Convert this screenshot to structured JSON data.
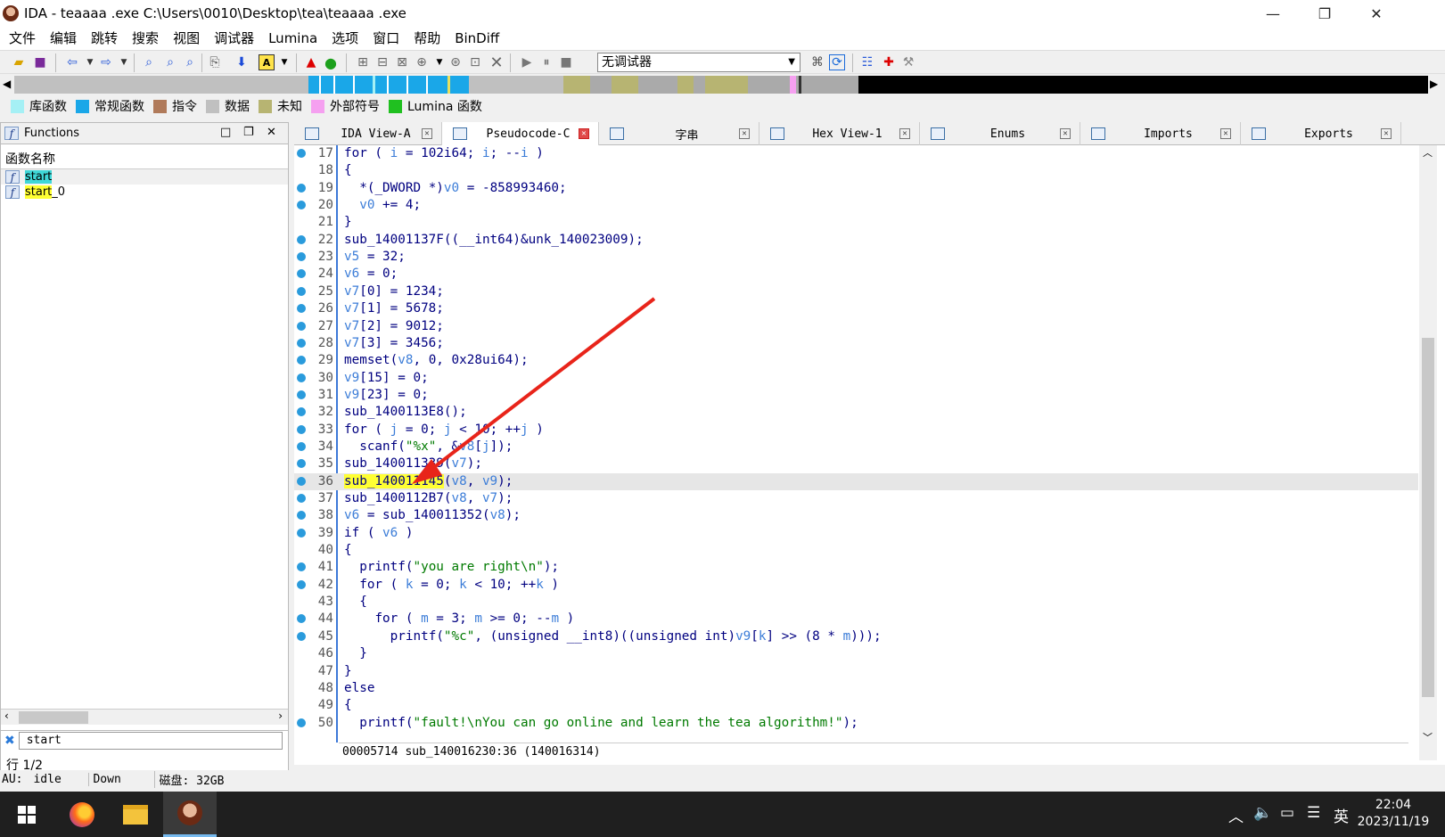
{
  "window": {
    "title": "IDA - teaaaa .exe C:\\Users\\0010\\Desktop\\tea\\teaaaa .exe",
    "minimize_glyph": "—",
    "maximize_glyph": "❐",
    "close_glyph": "✕"
  },
  "menu": [
    "文件",
    "编辑",
    "跳转",
    "搜索",
    "视图",
    "调试器",
    "Lumina",
    "选项",
    "窗口",
    "帮助",
    "BinDiff"
  ],
  "toolbar": {
    "debugger_select": "无调试器"
  },
  "legend": [
    {
      "label": "库函数",
      "color": "#a5f0f5"
    },
    {
      "label": "常规函数",
      "color": "#1aa7e8"
    },
    {
      "label": "指令",
      "color": "#b07a5a"
    },
    {
      "label": "数据",
      "color": "#c0c0c0"
    },
    {
      "label": "未知",
      "color": "#b7b472"
    },
    {
      "label": "外部符号",
      "color": "#f5a0f0"
    },
    {
      "label": "Lumina 函数",
      "color": "#20c020"
    }
  ],
  "functions_panel": {
    "title": "Functions",
    "column_header": "函数名称",
    "items": [
      "start",
      "start_0"
    ],
    "filter_value": "start",
    "status": "行 1/2"
  },
  "tabs": [
    {
      "label": "IDA View-A",
      "active": false
    },
    {
      "label": "Pseudocode-C",
      "active": true
    },
    {
      "label": "字串",
      "active": false
    },
    {
      "label": "Hex View-1",
      "active": false
    },
    {
      "label": "Enums",
      "active": false
    },
    {
      "label": "Imports",
      "active": false
    },
    {
      "label": "Exports",
      "active": false
    }
  ],
  "code": {
    "lines": [
      {
        "num": "17",
        "dot": true,
        "text": "for ( i = 102i64; i; --i )"
      },
      {
        "num": "18",
        "dot": false,
        "text": "{"
      },
      {
        "num": "19",
        "dot": true,
        "text": "  *(_DWORD *)v0 = -858993460;"
      },
      {
        "num": "20",
        "dot": true,
        "text": "  v0 += 4;"
      },
      {
        "num": "21",
        "dot": false,
        "text": "}"
      },
      {
        "num": "22",
        "dot": true,
        "text": "sub_14001137F((__int64)&unk_140023009);"
      },
      {
        "num": "23",
        "dot": true,
        "text": "v5 = 32;"
      },
      {
        "num": "24",
        "dot": true,
        "text": "v6 = 0;"
      },
      {
        "num": "25",
        "dot": true,
        "text": "v7[0] = 1234;"
      },
      {
        "num": "26",
        "dot": true,
        "text": "v7[1] = 5678;"
      },
      {
        "num": "27",
        "dot": true,
        "text": "v7[2] = 9012;"
      },
      {
        "num": "28",
        "dot": true,
        "text": "v7[3] = 3456;"
      },
      {
        "num": "29",
        "dot": true,
        "text": "memset(v8, 0, 0x28ui64);"
      },
      {
        "num": "30",
        "dot": true,
        "text": "v9[15] = 0;"
      },
      {
        "num": "31",
        "dot": true,
        "text": "v9[23] = 0;"
      },
      {
        "num": "32",
        "dot": true,
        "text": "sub_1400113E8();"
      },
      {
        "num": "33",
        "dot": true,
        "text": "for ( j = 0; j < 10; ++j )"
      },
      {
        "num": "34",
        "dot": true,
        "text": "  scanf(\"%x\", &v8[j]);"
      },
      {
        "num": "35",
        "dot": true,
        "text": "sub_140011339(v7);"
      },
      {
        "num": "36",
        "dot": true,
        "text": "sub_140011145(v8, v9);"
      },
      {
        "num": "37",
        "dot": true,
        "text": "sub_1400112B7(v8, v7);"
      },
      {
        "num": "38",
        "dot": true,
        "text": "v6 = sub_140011352(v8);"
      },
      {
        "num": "39",
        "dot": true,
        "text": "if ( v6 )"
      },
      {
        "num": "40",
        "dot": false,
        "text": "{"
      },
      {
        "num": "41",
        "dot": true,
        "text": "  printf(\"you are right\\n\");"
      },
      {
        "num": "42",
        "dot": true,
        "text": "  for ( k = 0; k < 10; ++k )"
      },
      {
        "num": "43",
        "dot": false,
        "text": "  {"
      },
      {
        "num": "44",
        "dot": true,
        "text": "    for ( m = 3; m >= 0; --m )"
      },
      {
        "num": "45",
        "dot": true,
        "text": "      printf(\"%c\", (unsigned __int8)((unsigned int)v9[k] >> (8 * m)));"
      },
      {
        "num": "46",
        "dot": false,
        "text": "  }"
      },
      {
        "num": "47",
        "dot": false,
        "text": "}"
      },
      {
        "num": "48",
        "dot": false,
        "text": "else"
      },
      {
        "num": "49",
        "dot": false,
        "text": "{"
      },
      {
        "num": "50",
        "dot": true,
        "text": "  printf(\"fault!\\nYou can go online and learn the tea algorithm!\");"
      }
    ],
    "highlighted_line": "36",
    "highlighted_symbol": "sub_140011145",
    "status": "00005714 sub_140016230:36 (140016314)"
  },
  "statusbar": {
    "au_label": "AU:",
    "au_state": "idle",
    "direction": "Down",
    "disk": "磁盘: 32GB"
  },
  "taskbar": {
    "ime": "英",
    "time": "22:04",
    "date": "2023/11/19"
  },
  "annotation": {
    "arrow_color": "#e8241a"
  }
}
